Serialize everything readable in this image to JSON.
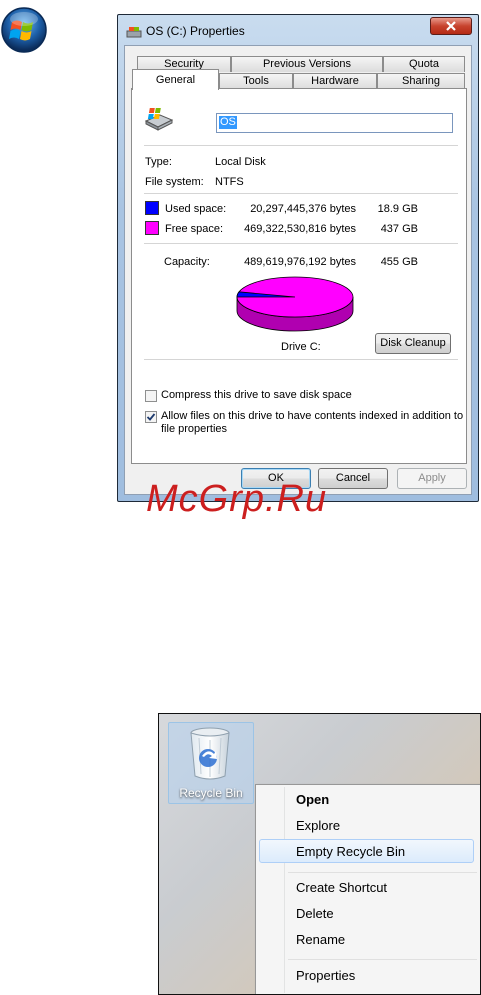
{
  "dialog": {
    "title": "OS (C:) Properties",
    "tabs_back": [
      "Security",
      "Previous Versions",
      "Quota"
    ],
    "tabs_front": [
      "General",
      "Tools",
      "Hardware",
      "Sharing"
    ],
    "drive_name": "OS",
    "type_label": "Type:",
    "type_value": "Local Disk",
    "fs_label": "File system:",
    "fs_value": "NTFS",
    "used_label": "Used space:",
    "used_bytes": "20,297,445,376 bytes",
    "used_gb": "18.9 GB",
    "free_label": "Free space:",
    "free_bytes": "469,322,530,816 bytes",
    "free_gb": "437 GB",
    "capacity_label": "Capacity:",
    "capacity_bytes": "489,619,976,192 bytes",
    "capacity_gb": "455 GB",
    "drive_label": "Drive C:",
    "disk_cleanup": "Disk Cleanup",
    "compress_label": "Compress this drive to save disk space",
    "index_label_1": "Allow files on this drive to have contents indexed in addition to",
    "index_label_2": "file properties",
    "compress_checked": false,
    "index_checked": true,
    "ok": "OK",
    "cancel": "Cancel",
    "apply": "Apply",
    "used_fraction": 0.0415,
    "colors": {
      "used": "#0000ff",
      "free": "#ff00ff"
    }
  },
  "watermark": "McGrp.Ru",
  "recycle": {
    "icon_label": "Recycle Bin",
    "menu": [
      "Open",
      "Explore",
      "Empty Recycle Bin",
      "Create Shortcut",
      "Delete",
      "Rename",
      "Properties"
    ],
    "highlighted": "Empty Recycle Bin"
  }
}
